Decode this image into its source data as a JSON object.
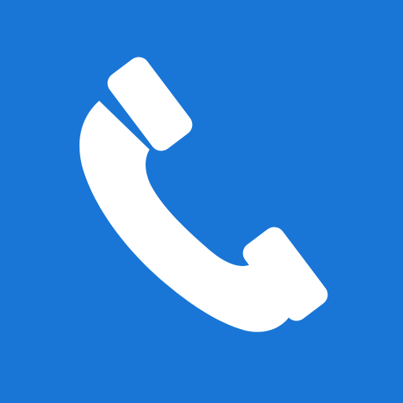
{
  "icon": {
    "name": "phone-icon",
    "background_color": "#1976d6",
    "glyph_color": "#ffffff"
  }
}
